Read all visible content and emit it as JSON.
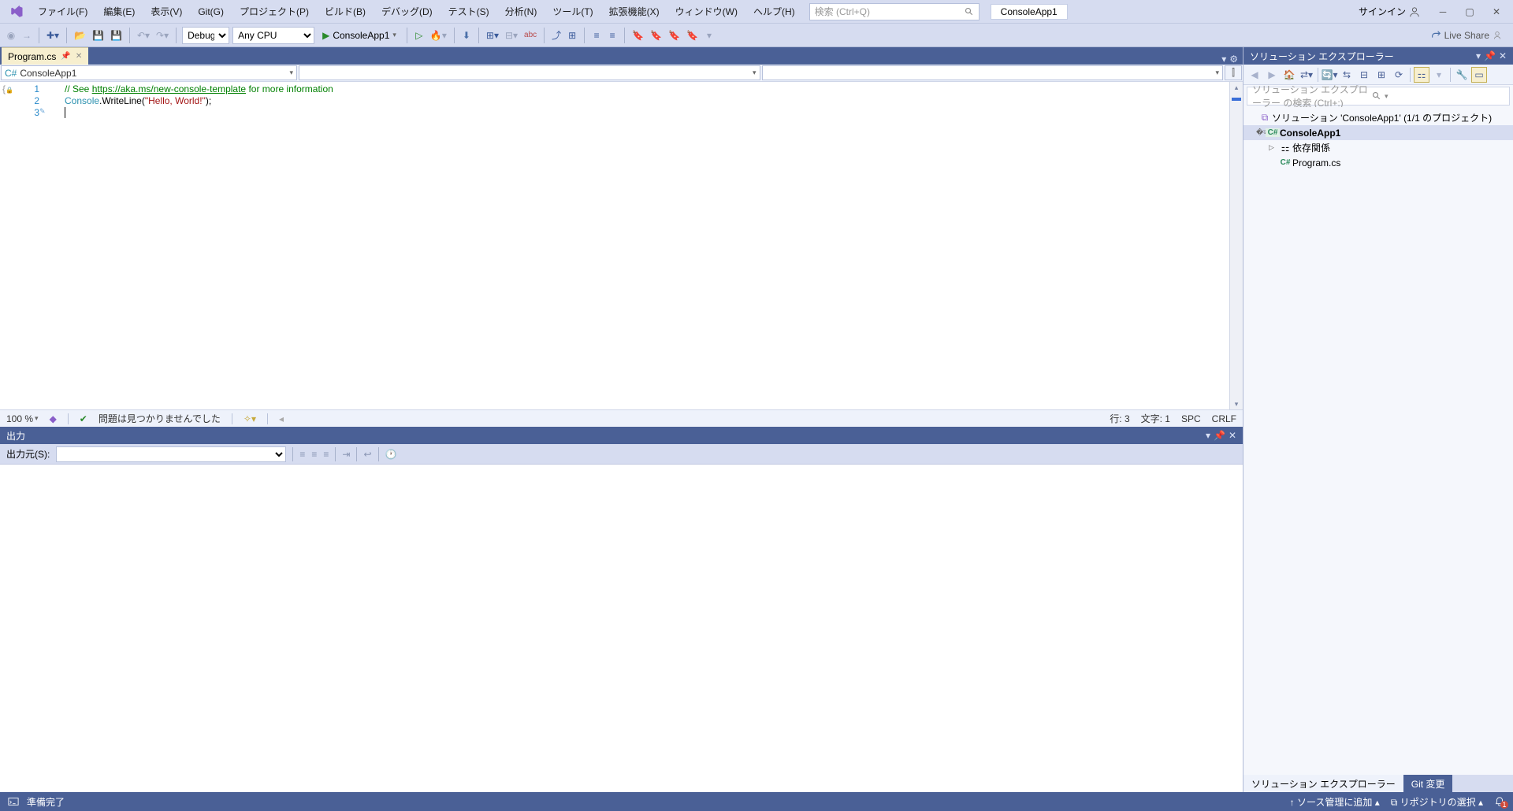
{
  "menu": {
    "items": [
      "ファイル(F)",
      "編集(E)",
      "表示(V)",
      "Git(G)",
      "プロジェクト(P)",
      "ビルド(B)",
      "デバッグ(D)",
      "テスト(S)",
      "分析(N)",
      "ツール(T)",
      "拡張機能(X)",
      "ウィンドウ(W)",
      "ヘルプ(H)"
    ],
    "search_placeholder": "検索 (Ctrl+Q)",
    "project_pill": "ConsoleApp1",
    "signin": "サインイン"
  },
  "toolbar": {
    "config": "Debug",
    "platform": "Any CPU",
    "run_label": "ConsoleApp1",
    "liveshare": "Live Share"
  },
  "tabs": {
    "active": "Program.cs"
  },
  "context": {
    "project": "ConsoleApp1"
  },
  "code": {
    "lines": [
      "1",
      "2",
      "3"
    ],
    "l1_pre": "// See ",
    "l1_link": "https://aka.ms/new-console-template",
    "l1_post": " for more information",
    "l2_cls": "Console",
    "l2_mid": ".WriteLine(",
    "l2_str": "\"Hello, World!\"",
    "l2_end": ");"
  },
  "ed_status": {
    "zoom": "100 %",
    "issues": "問題は見つかりませんでした",
    "line": "行: 3",
    "col": "文字: 1",
    "ins": "SPC",
    "eol": "CRLF"
  },
  "output": {
    "title": "出力",
    "from_label": "出力元(S):"
  },
  "sln": {
    "title": "ソリューション エクスプローラー",
    "search_placeholder": "ソリューション エクスプローラー の検索 (Ctrl+:)",
    "root": "ソリューション 'ConsoleApp1' (1/1 のプロジェクト)",
    "project": "ConsoleApp1",
    "deps": "依存関係",
    "file": "Program.cs",
    "tab1": "ソリューション エクスプローラー",
    "tab2": "Git 変更"
  },
  "status": {
    "ready": "準備完了",
    "source": "ソース管理に追加",
    "repo": "リポジトリの選択",
    "notif": "1"
  }
}
